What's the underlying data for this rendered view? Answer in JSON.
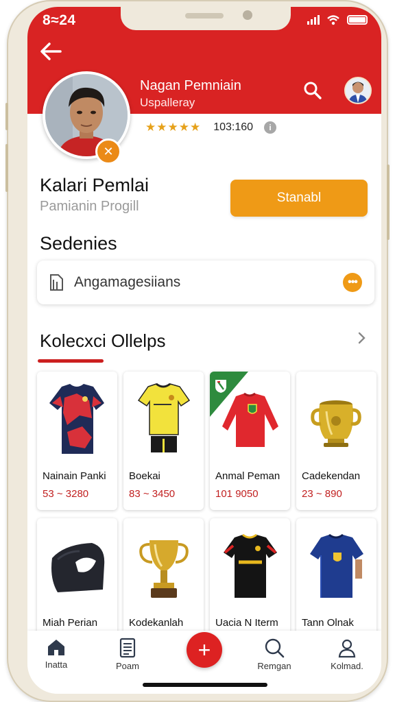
{
  "status_bar": {
    "time": "8≈24"
  },
  "header": {
    "title": "Nagan Pemniain",
    "subtitle": "Uspalleray",
    "back_icon": "arrow-left-icon",
    "search_icon": "search-icon",
    "brand_color": "#d92323"
  },
  "profile": {
    "rating_stars": "★★★★★",
    "rating_count": "103:160",
    "info_icon": "i",
    "badge_icon": "✕",
    "name": "Kalari Pemlai",
    "subtitle": "Pamianin Progill",
    "primary_button": "Stanabl",
    "accent_color": "#ef9a16"
  },
  "settings": {
    "title": "Sedenies",
    "select_value": "Angamagesiians",
    "more_icon": "•••"
  },
  "collection": {
    "title": "Kolecxci Ollelps",
    "items": [
      {
        "name": "Nainain Panki",
        "price": "53 ~ 3280",
        "icon": "jersey-red-camo-icon"
      },
      {
        "name": "Boekai",
        "price": "83 ~ 3450",
        "icon": "jersey-yellow-icon"
      },
      {
        "name": "Anmal Peman",
        "price": "101   9050",
        "icon": "jersey-red-longsleeve-icon"
      },
      {
        "name": "Cadekendan",
        "price": "23 ~ 890",
        "icon": "golden-pot-icon"
      },
      {
        "name": "Miah Perian",
        "price": "",
        "icon": "black-garment-icon"
      },
      {
        "name": "Kodekanlah",
        "price": "",
        "icon": "trophy-icon"
      },
      {
        "name": "Uacia N Iterm",
        "price": "",
        "icon": "jersey-black-icon"
      },
      {
        "name": "Tann Olnak",
        "price": "",
        "icon": "jersey-blue-icon"
      }
    ]
  },
  "tabbar": {
    "tabs": [
      {
        "label": "Inatta",
        "icon": "home-icon"
      },
      {
        "label": "Poam",
        "icon": "document-icon"
      },
      {
        "label": "Remgan",
        "icon": "search-icon"
      },
      {
        "label": "Kolmad.",
        "icon": "profile-icon"
      }
    ],
    "fab_label": "+"
  }
}
